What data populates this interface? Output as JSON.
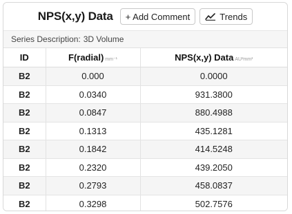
{
  "header": {
    "title": "NPS(x,y) Data",
    "add_comment_label": "+ Add Comment",
    "trends_label": "Trends",
    "trends_icon": "trend-line-icon"
  },
  "series": {
    "label": "Series Description:",
    "value": "3D Volume"
  },
  "table": {
    "columns": [
      {
        "label": "ID",
        "unit": ""
      },
      {
        "label": "F(radial)",
        "unit": "mm⁻¹"
      },
      {
        "label": "NPS(x,y) Data",
        "unit": "AU²mm³"
      }
    ],
    "rows": [
      {
        "id": "B2",
        "f_radial": "0.000",
        "nps": "0.0000"
      },
      {
        "id": "B2",
        "f_radial": "0.0340",
        "nps": "931.3800"
      },
      {
        "id": "B2",
        "f_radial": "0.0847",
        "nps": "880.4988"
      },
      {
        "id": "B2",
        "f_radial": "0.1313",
        "nps": "435.1281"
      },
      {
        "id": "B2",
        "f_radial": "0.1842",
        "nps": "414.5248"
      },
      {
        "id": "B2",
        "f_radial": "0.2320",
        "nps": "439.2050"
      },
      {
        "id": "B2",
        "f_radial": "0.2793",
        "nps": "458.0837"
      },
      {
        "id": "B2",
        "f_radial": "0.3298",
        "nps": "502.7576"
      }
    ]
  },
  "colors": {
    "border": "#d8d8d8",
    "row_alt": "#f5f5f5"
  }
}
